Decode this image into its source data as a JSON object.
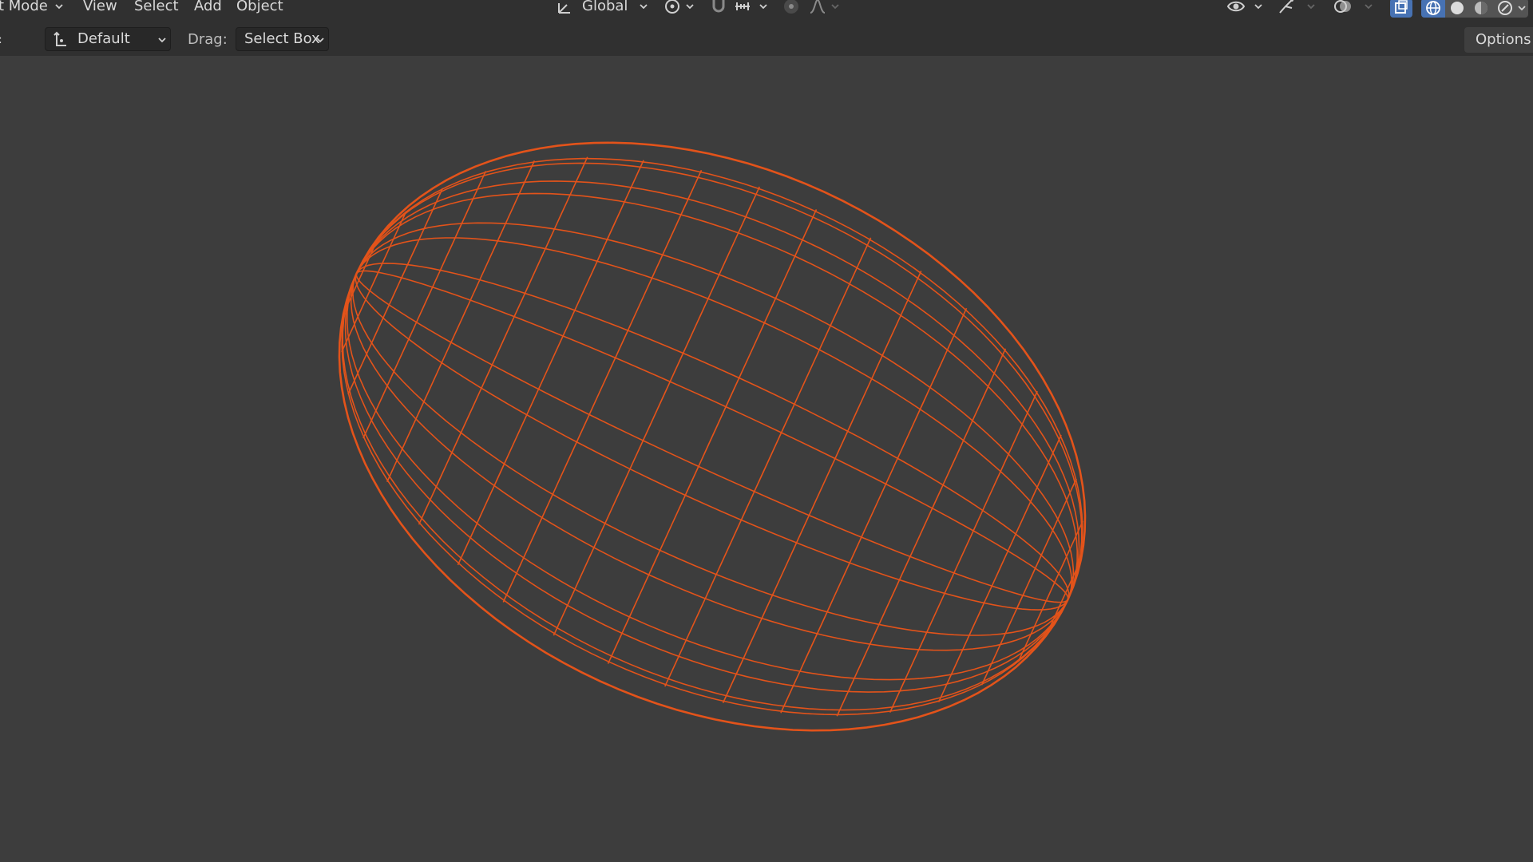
{
  "header": {
    "mode_label": "t Mode",
    "menus": [
      "View",
      "Select",
      "Add",
      "Object"
    ],
    "orientation": "Global",
    "pivot_label": "Default",
    "drag_label": "Drag:",
    "drag_value": "Select Box",
    "options_label": "Options",
    "icons": {
      "transform_orientation": "transform-orientation-icon",
      "pivot": "pivot-point-icon",
      "snap": "snap-magnet-icon",
      "snap_increment": "snap-increment-icon",
      "proportional": "proportional-editing-icon",
      "falloff": "falloff-curve-icon",
      "visibility": "object-visibility-icon",
      "gizmo": "gizmo-icon",
      "overlay": "overlay-icon",
      "xray": "xray-icon",
      "shading_wireframe": "wireframe-shading-icon",
      "shading_solid": "solid-shading-icon",
      "shading_material": "material-shading-icon",
      "shading_rendered": "rendered-shading-icon"
    }
  },
  "viewport": {
    "object": "ellipsoid-wireframe",
    "selection_color": "#e3531a",
    "background_color": "#3d3d3d"
  }
}
